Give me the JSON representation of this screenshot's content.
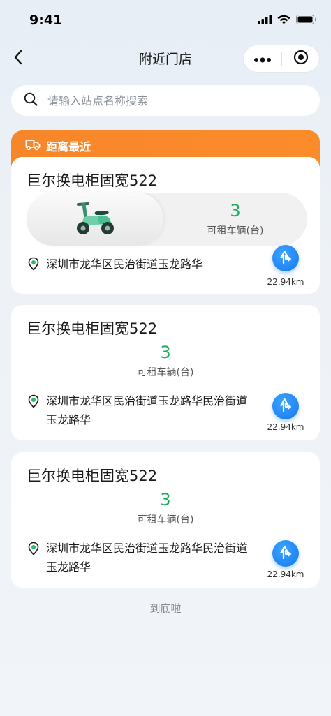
{
  "status_bar": {
    "time": "9:41"
  },
  "nav": {
    "title": "附近门店"
  },
  "search": {
    "placeholder": "请输入站点名称搜索"
  },
  "featured": {
    "banner": "距离最近",
    "store": {
      "name": "巨尔换电柜固宽522",
      "count": "3",
      "count_label": "可租车辆(台)",
      "address": "深圳市龙华区民治街道玉龙路华",
      "distance": "22.94km"
    }
  },
  "stores": [
    {
      "name": "巨尔换电柜固宽522",
      "count": "3",
      "count_label": "可租车辆(台)",
      "address": "深圳市龙华区民治街道玉龙路华民治街道玉龙路华",
      "distance": "22.94km"
    },
    {
      "name": "巨尔换电柜固宽522",
      "count": "3",
      "count_label": "可租车辆(台)",
      "address": "深圳市龙华区民治街道玉龙路华民治街道玉龙路华",
      "distance": "22.94km"
    }
  ],
  "footer": {
    "end_text": "到底啦"
  },
  "colors": {
    "accent_orange": "#f7862a",
    "count_green": "#1eaa62",
    "nav_blue": "#1677f2"
  }
}
